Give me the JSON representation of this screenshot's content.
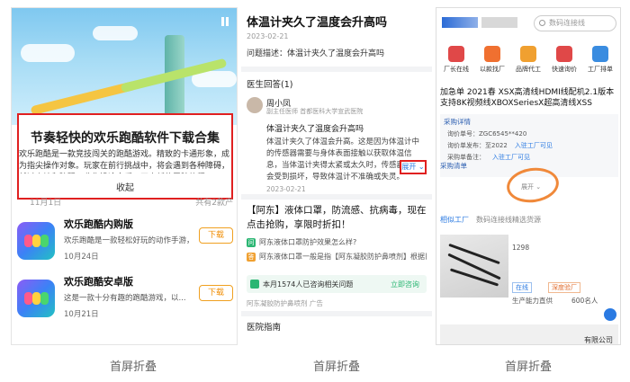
{
  "panel1": {
    "article_title": "节奏轻快的欢乐跑酷软件下载合集",
    "article_body": "欢乐跑酷是一款竞技闯关的跑酷游戏。精致的卡通形象，成为指尖操作对象。玩家在前行挑战中，将会遇到各种障碍，越过山坡和障碍，收集沿途金币，开启新的冒险旅程。",
    "collapse_label": "收起",
    "date": "11月1日",
    "count": "共有2款产",
    "apps": [
      {
        "name": "欢乐跑酷内购版",
        "desc": "欢乐跑酷是一款轻松好玩的动作手游，",
        "date": "10月24日",
        "download": "下载"
      },
      {
        "name": "欢乐跑酷安卓版",
        "desc": "这是一款十分有趣的跑酷游戏，以...",
        "date": "10月21日",
        "download": "下载"
      }
    ]
  },
  "panel2": {
    "title": "体温计夹久了温度会升高吗",
    "date": "2023-02-21",
    "question_desc": "问题描述：体温计夹久了温度会升高吗",
    "answers_header": "医生回答(1)",
    "doctor_name": "周小凤",
    "doctor_role": "副主任医师  首都医科大学宣武医院",
    "answer_question": "体温计夹久了温度会升高吗",
    "answer_body": "体温计夹久了体温会升高。这是因为体温计中的传感器需要与身体表面接触以获取体温信息，当体温计夹得太紧或太久时，传感器可能会受到损坏，导致体温计不准确或失灵。",
    "answer_date": "2023-02-21",
    "expand_label": "展开 ⌄",
    "ad_title": "【阿东】液体口罩，防流感、抗病毒，现在点击抢购，享限时折扣！",
    "ad_rows": [
      "阿东液体口罩防护效果怎么样?",
      "阿东液体口罩一般是指【阿东凝胶防护鼻喷剂】根据目前的研究结果来看,它是可靠的,它能够阻断病毒"
    ],
    "ad_box_text": "本月1574人已咨询相关问题",
    "ad_box_link": "立即咨询",
    "ad_source": "阿东凝胶防护鼻喷剂  广告",
    "guide": "医院指南"
  },
  "panel3": {
    "search_placeholder": "数码连接线",
    "categories": [
      {
        "label": "厂长在线",
        "color": "#e04848"
      },
      {
        "label": "以款找厂",
        "color": "#f07030"
      },
      {
        "label": "品牌代工",
        "color": "#f0a030"
      },
      {
        "label": "快速询价",
        "color": "#e04848"
      },
      {
        "label": "工厂排单",
        "color": "#3a8ce0"
      }
    ],
    "product_title": "加急单 2021春 XSX高清线HDMI线配机2.1版本支持8K视频线XBOXSeriesX超高清线XSS",
    "specs_header": "采购详情",
    "spec_rows": [
      {
        "k": "询价单号：",
        "v": "ZGC6545**420",
        "link": ""
      },
      {
        "k": "询价单发布：",
        "v": "至2022",
        "link": "入驻工厂可见"
      },
      {
        "k": "采购单备注：",
        "v": "",
        "link": "入驻工厂可见"
      }
    ],
    "buy_label": "采购清单",
    "expand_label": "展开 ⌄",
    "tab_active": "相似工厂",
    "tab_other": "数码连接线精选货源",
    "price": "1298",
    "tag_online": "在线",
    "tag_factory": "深度验厂",
    "factory_line": "生产能力直供",
    "deal_line": "600名人",
    "bottom_text": "有限公司"
  },
  "captions": [
    "首屏折叠",
    "首屏折叠",
    "首屏折叠"
  ]
}
